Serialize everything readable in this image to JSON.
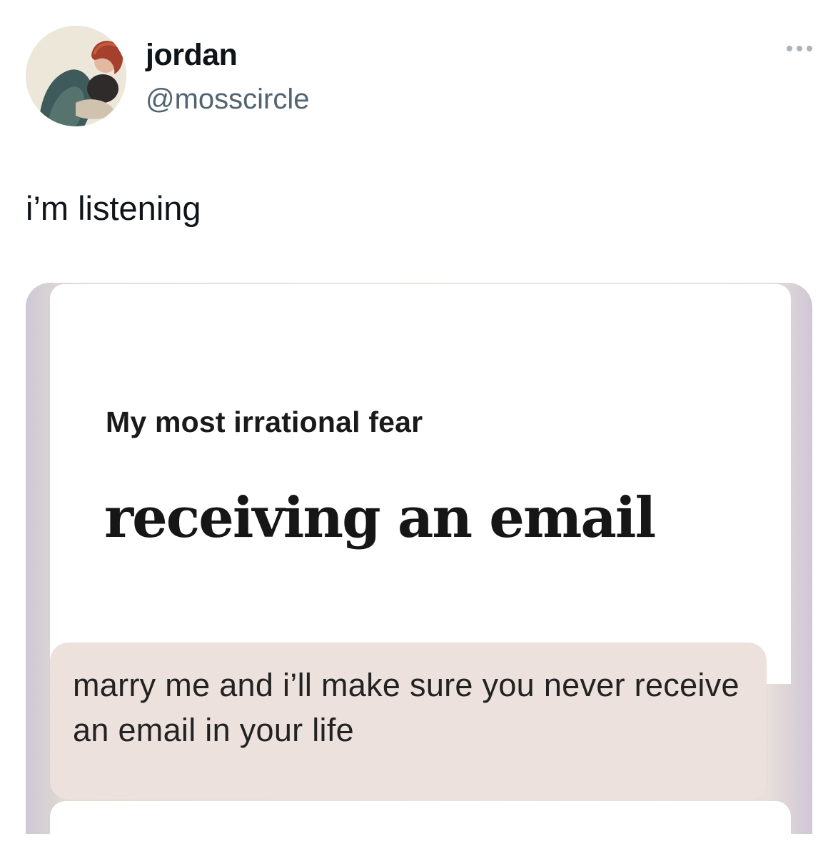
{
  "tweet": {
    "display_name": "jordan",
    "handle": "@mosscircle",
    "text": "i’m listening",
    "more_icon": "more-horizontal-icon"
  },
  "media": {
    "prompt_label": "My most irrational fear",
    "prompt_answer": "receiving an email",
    "comment": "marry me and i’ll make sure you never receive an email in your life"
  },
  "colors": {
    "name": "#0f1419",
    "handle": "#536471",
    "comment_bubble": "#ece1dc"
  }
}
